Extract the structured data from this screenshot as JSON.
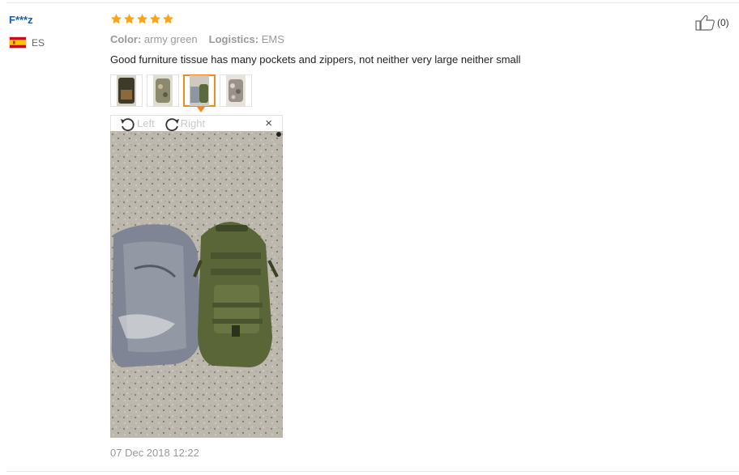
{
  "buyer": {
    "name": "F***z",
    "country_code": "ES"
  },
  "review": {
    "rating": 5,
    "color_label": "Color:",
    "color_value": "army green",
    "logistics_label": "Logistics:",
    "logistics_value": "EMS",
    "text": "Good furniture tissue has many pockets and zippers, not neither very large neither small",
    "date": "07 Dec 2018 12:22",
    "helpful_count": "(0)",
    "thumbnail_count": 4,
    "selected_thumbnail": 3
  },
  "viewer": {
    "rotate_left_label": "Left",
    "rotate_right_label": "Right",
    "close_label": "×"
  },
  "colors": {
    "star": "#f7a51a",
    "buyer_name": "#1a5aa6",
    "thumb_active_border": "#f08a24",
    "muted_text": "#999999"
  },
  "icons": {
    "rating": "star-icon",
    "helpful": "thumbs-up-icon",
    "rotate_left": "rotate-left-icon",
    "rotate_right": "rotate-right-icon",
    "close": "close-icon",
    "flag": "spain-flag-icon"
  }
}
